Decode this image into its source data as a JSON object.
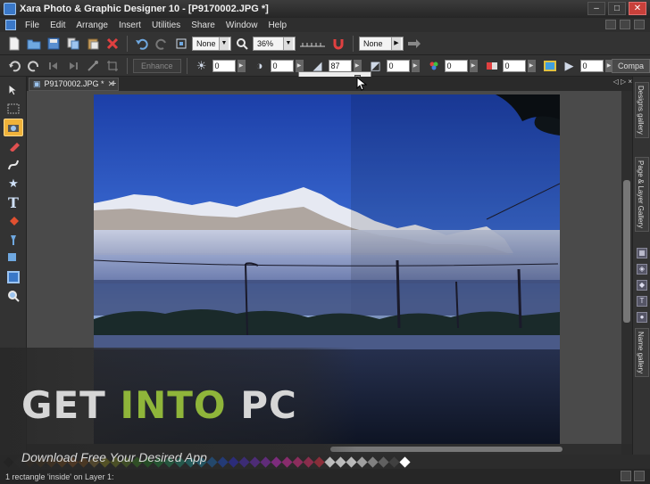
{
  "window": {
    "title": "Xara Photo & Graphic Designer 10 - [P9170002.JPG *]",
    "controls": [
      "–",
      "□",
      "✕"
    ]
  },
  "menu": {
    "items": [
      "File",
      "Edit",
      "Arrange",
      "Insert",
      "Utilities",
      "Share",
      "Window",
      "Help"
    ]
  },
  "toolbar1": {
    "zoom_select": "None",
    "zoom_percent": "36%",
    "quality_select": "None"
  },
  "toolbar2": {
    "enhance_label": "Enhance",
    "brightness": "0",
    "contrast": "0",
    "saturation_label": "",
    "sharpen": "87",
    "shadow": "0",
    "color_temp": "0",
    "color": "0",
    "extra": "0",
    "compare_label": "Compa"
  },
  "document": {
    "tab_label": "P9170002.JPG *",
    "close": "✕",
    "new_tab": "+",
    "nav": "◁ ▷ ×"
  },
  "gallery_tabs": [
    "Designs gallery",
    "Page & Layer Gallery",
    "Name gallery"
  ],
  "status": {
    "text": "1 rectangle 'inside' on Layer 1:"
  },
  "watermark": {
    "title_part1": "GET ",
    "title_green": "INTO",
    "title_part2": " PC",
    "subtitle": "Download Free Your Desired App"
  },
  "palette_colors": [
    "#000000",
    "#333333",
    "#5a3a1a",
    "#7a4a10",
    "#a05a10",
    "#c06a10",
    "#d07020",
    "#b86a18",
    "#c8a040",
    "#c8c020",
    "#a0b020",
    "#70a020",
    "#40a020",
    "#209020",
    "#20a040",
    "#20a060",
    "#20a080",
    "#20a0a0",
    "#2090b0",
    "#2070c0",
    "#2050d0",
    "#3030d0",
    "#5030c0",
    "#7030c0",
    "#9030c0",
    "#c030c0",
    "#d030a0",
    "#d03080",
    "#c03060",
    "#b03040",
    "#e0e0e0",
    "#d0d0d0",
    "#c0c0c0",
    "#a0a0a0",
    "#808080",
    "#606060",
    "#404040",
    "#ffffff"
  ]
}
